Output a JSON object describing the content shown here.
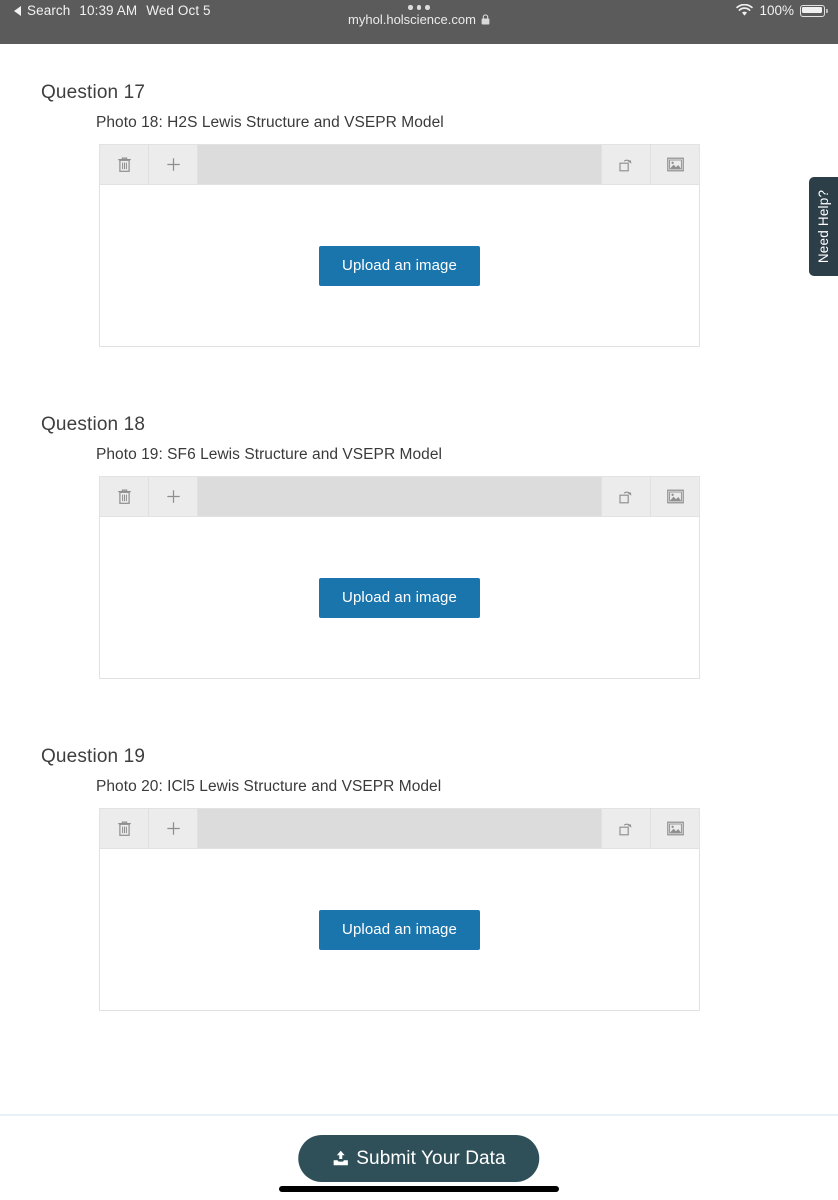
{
  "statusbar": {
    "back_label": "Search",
    "time": "10:39 AM",
    "date": "Wed Oct 5",
    "battery_percent": "100%",
    "url": "myhol.holscience.com",
    "wifi_icon": "wifi-icon",
    "battery_icon": "battery-full-icon",
    "lock_icon": "lock-icon",
    "tab_overview_icon": "three-dots-icon"
  },
  "questions": [
    {
      "title": "Question 17",
      "photo_label": "Photo 18: H2S Lewis Structure and VSEPR Model",
      "toolbar": {
        "delete_icon": "trash-icon",
        "add_icon": "plus-icon",
        "rotate_icon": "rotate-icon",
        "image_icon": "image-icon"
      },
      "upload_label": "Upload an image"
    },
    {
      "title": "Question 18",
      "photo_label": "Photo 19: SF6 Lewis Structure and VSEPR Model",
      "toolbar": {
        "delete_icon": "trash-icon",
        "add_icon": "plus-icon",
        "rotate_icon": "rotate-icon",
        "image_icon": "image-icon"
      },
      "upload_label": "Upload an image"
    },
    {
      "title": "Question 19",
      "photo_label": "Photo 20: ICl5 Lewis Structure and VSEPR Model",
      "toolbar": {
        "delete_icon": "trash-icon",
        "add_icon": "plus-icon",
        "rotate_icon": "rotate-icon",
        "image_icon": "image-icon"
      },
      "upload_label": "Upload an image"
    }
  ],
  "need_help": {
    "label": "Need Help?"
  },
  "footer": {
    "submit_label": "Submit Your Data",
    "submit_icon": "upload-icon"
  },
  "colors": {
    "statusbar_bg": "#5b5b5b",
    "upload_button": "#1a75ad",
    "submit_button": "#2f5059",
    "need_help_tab": "#2c3e48",
    "toolbar_bg": "#dcdcdc",
    "toolbar_button_bg": "#ececec"
  }
}
